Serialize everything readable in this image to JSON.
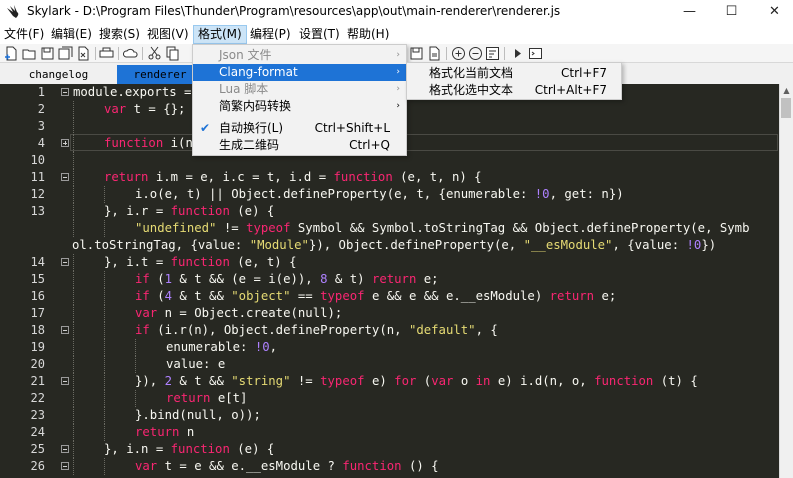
{
  "window": {
    "title": "Skylark - D:\\Program Files\\Thunder\\Program\\resources\\app\\out\\main-renderer\\renderer.js",
    "minimize": "—",
    "maximize": "☐",
    "close": "✕"
  },
  "menubar": [
    {
      "label": "文件(F)",
      "active": false
    },
    {
      "label": "编辑(E)",
      "active": false
    },
    {
      "label": "搜索(S)",
      "active": false
    },
    {
      "label": "视图(V)",
      "active": false
    },
    {
      "label": "格式(M)",
      "active": true
    },
    {
      "label": "编程(P)",
      "active": false
    },
    {
      "label": "设置(T)",
      "active": false
    },
    {
      "label": "帮助(H)",
      "active": false
    }
  ],
  "toolbar_icons": [
    "new-file-icon",
    "open-folder-icon",
    "save-icon",
    "save-all-icon",
    "close-file-icon",
    "print-icon",
    "cloud-icon",
    "cut-icon",
    "copy-icon",
    "zoom-in-icon",
    "zoom-out-icon",
    "word-wrap-icon",
    "run-icon",
    "terminal-icon"
  ],
  "tabs": [
    {
      "label": "changelog",
      "active": false
    },
    {
      "label": "renderer",
      "active": true
    }
  ],
  "format_menu": {
    "items": [
      {
        "label": "Json 文件",
        "shortcut": "",
        "submenu": true,
        "disabled": true,
        "checked": false,
        "selected": false
      },
      {
        "label": "Clang-format",
        "shortcut": "",
        "submenu": true,
        "disabled": false,
        "checked": false,
        "selected": true
      },
      {
        "label": "Lua 脚本",
        "shortcut": "",
        "submenu": true,
        "disabled": true,
        "checked": false,
        "selected": false
      },
      {
        "label": "简繁内码转换",
        "shortcut": "",
        "submenu": true,
        "disabled": false,
        "checked": false,
        "selected": false
      },
      {
        "label": "自动换行(L)",
        "shortcut": "Ctrl+Shift+L",
        "submenu": false,
        "disabled": false,
        "checked": true,
        "selected": false
      },
      {
        "label": "生成二维码",
        "shortcut": "Ctrl+Q",
        "submenu": false,
        "disabled": false,
        "checked": false,
        "selected": false
      }
    ],
    "submenu": [
      {
        "label": "格式化当前文档",
        "shortcut": "Ctrl+F7"
      },
      {
        "label": "格式化选中文本",
        "shortcut": "Ctrl+Alt+F7"
      }
    ],
    "check_mark": "✔",
    "arrow": "›"
  },
  "editor": {
    "theme_colors": {
      "background": "#272822",
      "keyword": "#f92672",
      "function": "#66d9ef",
      "string": "#e6db74",
      "number": "#ae81ff",
      "text": "#f8f8f2"
    },
    "lines": [
      {
        "n": "1",
        "fold": "minus",
        "indent": 0,
        "tokens": [
          [
            "t",
            "module.exports = "
          ]
        ]
      },
      {
        "n": "2",
        "fold": "",
        "indent": 1,
        "tokens": [
          [
            "k",
            "var"
          ],
          [
            "t",
            " t = {};"
          ]
        ]
      },
      {
        "n": "3",
        "fold": "",
        "indent": 1,
        "tokens": []
      },
      {
        "n": "4",
        "fold": "plus",
        "indent": 1,
        "tokens": [
          [
            "k",
            "function"
          ],
          [
            "t",
            " i(n"
          ]
        ]
      },
      {
        "n": "10",
        "fold": "",
        "indent": 1,
        "tokens": []
      },
      {
        "n": "11",
        "fold": "minus",
        "indent": 1,
        "tokens": [
          [
            "k",
            "return"
          ],
          [
            "t",
            " i.m = e, i.c = t, i.d = "
          ],
          [
            "k",
            "function"
          ],
          [
            "t",
            " (e, t, n) {"
          ]
        ]
      },
      {
        "n": "12",
        "fold": "",
        "indent": 2,
        "tokens": [
          [
            "t",
            "i.o(e, t) || Object.defineProperty(e, t, {enumerable: "
          ],
          [
            "n",
            "!0"
          ],
          [
            "t",
            ", get: n})"
          ]
        ]
      },
      {
        "n": "13",
        "fold": "",
        "indent": 1,
        "tokens": [
          [
            "t",
            "}, i.r = "
          ],
          [
            "k",
            "function"
          ],
          [
            "t",
            " (e) {"
          ]
        ]
      },
      {
        "n": "",
        "fold": "",
        "indent": 2,
        "tokens": [
          [
            "s",
            "\"undefined\""
          ],
          [
            "t",
            " != "
          ],
          [
            "k",
            "typeof"
          ],
          [
            "t",
            " Symbol && Symbol.toStringTag && Object.defineProperty(e, Symb"
          ]
        ]
      },
      {
        "n": "",
        "fold": "",
        "indent": -1,
        "tokens": [
          [
            "t",
            "ol.toStringTag, {value: "
          ],
          [
            "s",
            "\"Module\""
          ],
          [
            "t",
            "}), Object.defineProperty(e, "
          ],
          [
            "s",
            "\"__esModule\""
          ],
          [
            "t",
            ", {value: "
          ],
          [
            "n",
            "!0"
          ],
          [
            "t",
            "})"
          ]
        ]
      },
      {
        "n": "14",
        "fold": "minus",
        "indent": 1,
        "tokens": [
          [
            "t",
            "}, i.t = "
          ],
          [
            "k",
            "function"
          ],
          [
            "t",
            " (e, t) {"
          ]
        ]
      },
      {
        "n": "15",
        "fold": "",
        "indent": 2,
        "tokens": [
          [
            "k",
            "if"
          ],
          [
            "t",
            " ("
          ],
          [
            "n",
            "1"
          ],
          [
            "t",
            " & t && (e = i(e)), "
          ],
          [
            "n",
            "8"
          ],
          [
            "t",
            " & t) "
          ],
          [
            "k",
            "return"
          ],
          [
            "t",
            " e;"
          ]
        ]
      },
      {
        "n": "16",
        "fold": "",
        "indent": 2,
        "tokens": [
          [
            "k",
            "if"
          ],
          [
            "t",
            " ("
          ],
          [
            "n",
            "4"
          ],
          [
            "t",
            " & t && "
          ],
          [
            "s",
            "\"object\""
          ],
          [
            "t",
            " == "
          ],
          [
            "k",
            "typeof"
          ],
          [
            "t",
            " e && e && e.__esModule) "
          ],
          [
            "k",
            "return"
          ],
          [
            "t",
            " e;"
          ]
        ]
      },
      {
        "n": "17",
        "fold": "",
        "indent": 2,
        "tokens": [
          [
            "k",
            "var"
          ],
          [
            "t",
            " n = Object.create(null);"
          ]
        ]
      },
      {
        "n": "18",
        "fold": "minus",
        "indent": 2,
        "tokens": [
          [
            "k",
            "if"
          ],
          [
            "t",
            " (i.r(n), Object.defineProperty(n, "
          ],
          [
            "s",
            "\"default\""
          ],
          [
            "t",
            ", {"
          ]
        ]
      },
      {
        "n": "19",
        "fold": "",
        "indent": 3,
        "tokens": [
          [
            "t",
            "enumerable: "
          ],
          [
            "n",
            "!0"
          ],
          [
            "t",
            ","
          ]
        ]
      },
      {
        "n": "20",
        "fold": "",
        "indent": 3,
        "tokens": [
          [
            "t",
            "value: e"
          ]
        ]
      },
      {
        "n": "21",
        "fold": "minus",
        "indent": 2,
        "tokens": [
          [
            "t",
            "}), "
          ],
          [
            "n",
            "2"
          ],
          [
            "t",
            " & t && "
          ],
          [
            "s",
            "\"string\""
          ],
          [
            "t",
            " != "
          ],
          [
            "k",
            "typeof"
          ],
          [
            "t",
            " e) "
          ],
          [
            "k",
            "for"
          ],
          [
            "t",
            " ("
          ],
          [
            "k",
            "var"
          ],
          [
            "t",
            " o "
          ],
          [
            "k",
            "in"
          ],
          [
            "t",
            " e) i.d(n, o, "
          ],
          [
            "k",
            "function"
          ],
          [
            "t",
            " (t) {"
          ]
        ]
      },
      {
        "n": "22",
        "fold": "",
        "indent": 3,
        "tokens": [
          [
            "k",
            "return"
          ],
          [
            "t",
            " e[t]"
          ]
        ]
      },
      {
        "n": "23",
        "fold": "",
        "indent": 2,
        "tokens": [
          [
            "t",
            "}.bind(null, o));"
          ]
        ]
      },
      {
        "n": "24",
        "fold": "",
        "indent": 2,
        "tokens": [
          [
            "k",
            "return"
          ],
          [
            "t",
            " n"
          ]
        ]
      },
      {
        "n": "25",
        "fold": "minus",
        "indent": 1,
        "tokens": [
          [
            "t",
            "}, i.n = "
          ],
          [
            "k",
            "function"
          ],
          [
            "t",
            " (e) {"
          ]
        ]
      },
      {
        "n": "26",
        "fold": "minus",
        "indent": 2,
        "tokens": [
          [
            "k",
            "var"
          ],
          [
            "t",
            " t = e && e.__esModule ? "
          ],
          [
            "k",
            "function"
          ],
          [
            "t",
            " () {"
          ]
        ]
      }
    ]
  }
}
